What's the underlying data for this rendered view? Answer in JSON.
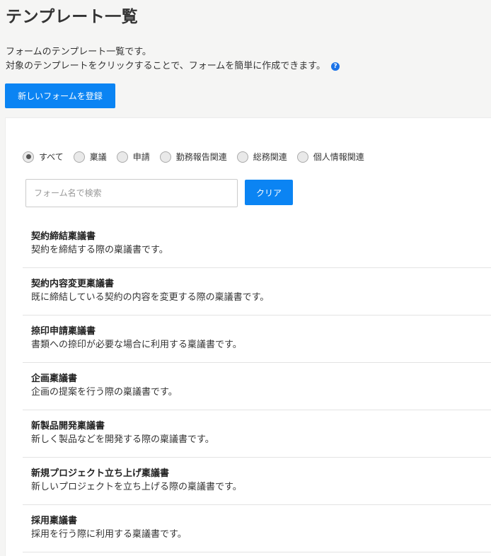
{
  "header": {
    "title": "テンプレート一覧",
    "intro_line1": "フォームのテンプレート一覧です。",
    "intro_line2": "対象のテンプレートをクリックすることで、フォームを簡単に作成できます。",
    "help_icon": "?"
  },
  "actions": {
    "register_label": "新しいフォームを登録"
  },
  "filters": {
    "selected": "すべて",
    "options": [
      "すべて",
      "稟議",
      "申請",
      "勤務報告関連",
      "総務関連",
      "個人情報関連"
    ]
  },
  "search": {
    "placeholder": "フォーム名で検索",
    "value": "",
    "clear_label": "クリア"
  },
  "templates": [
    {
      "title": "契約締結稟議書",
      "description": "契約を締結する際の稟議書です。"
    },
    {
      "title": "契約内容変更稟議書",
      "description": "既に締結している契約の内容を変更する際の稟議書です。"
    },
    {
      "title": "捺印申請稟議書",
      "description": "書類への捺印が必要な場合に利用する稟議書です。"
    },
    {
      "title": "企画稟議書",
      "description": "企画の提案を行う際の稟議書です。"
    },
    {
      "title": "新製品開発稟議書",
      "description": "新しく製品などを開発する際の稟議書です。"
    },
    {
      "title": "新規プロジェクト立ち上げ稟議書",
      "description": "新しいプロジェクトを立ち上げる際の稟議書です。"
    },
    {
      "title": "採用稟議書",
      "description": "採用を行う際に利用する稟議書です。"
    }
  ],
  "colors": {
    "primary": "#0b84f3",
    "background": "#f5f5f4",
    "panel": "#ffffff"
  }
}
